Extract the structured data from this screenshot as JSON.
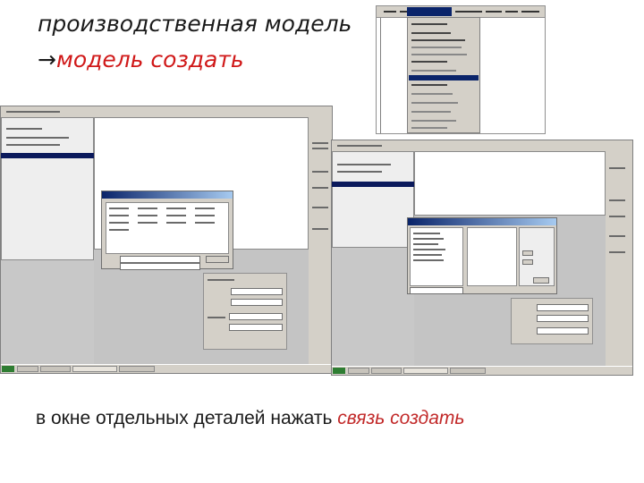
{
  "slide": {
    "title_line1": "производственная модель",
    "title_arrow": "→",
    "title_line2": "модель создать",
    "caption_prefix": "в  окне отдельных деталей нажать ",
    "caption_emphasis": "связь создать"
  },
  "colors": {
    "accent": "#d01818",
    "text": "#1a1a1a",
    "window_gray": "#c0c0c0",
    "title_bar": "#0a246a"
  },
  "screenshots": [
    {
      "name": "menu-dropdown"
    },
    {
      "name": "production-model-window"
    },
    {
      "name": "separate-details-window"
    }
  ]
}
